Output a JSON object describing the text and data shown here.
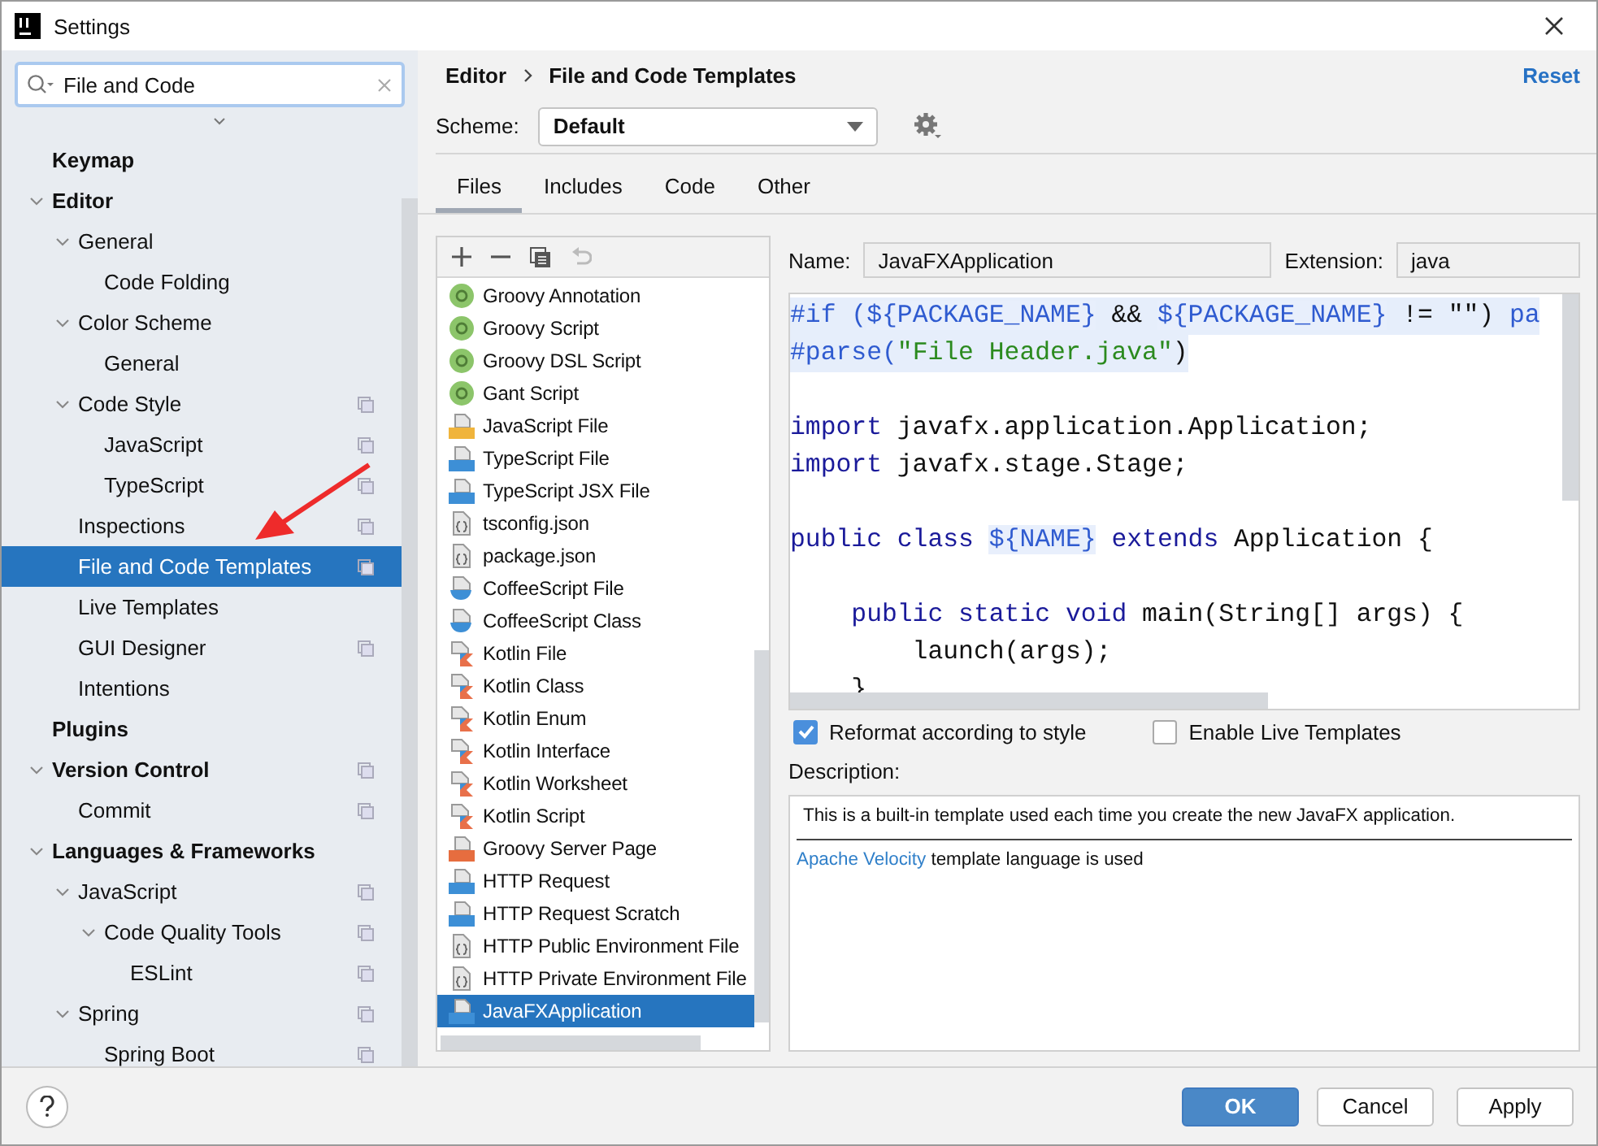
{
  "window": {
    "title": "Settings"
  },
  "search": {
    "value": "File and Code"
  },
  "tree": [
    {
      "label": "Keymap",
      "selected": false,
      "project_scoped": false
    },
    {
      "label": "Editor",
      "selected": false,
      "project_scoped": false,
      "expanded": true,
      "children": [
        {
          "label": "General",
          "selected": false,
          "project_scoped": false,
          "expanded": true,
          "children": [
            {
              "label": "Code Folding",
              "selected": false,
              "project_scoped": false
            }
          ]
        },
        {
          "label": "Color Scheme",
          "selected": false,
          "project_scoped": false,
          "expanded": true,
          "children": [
            {
              "label": "General",
              "selected": false,
              "project_scoped": false
            }
          ]
        },
        {
          "label": "Code Style",
          "selected": false,
          "project_scoped": true,
          "expanded": true,
          "children": [
            {
              "label": "JavaScript",
              "selected": false,
              "project_scoped": true
            },
            {
              "label": "TypeScript",
              "selected": false,
              "project_scoped": true
            }
          ]
        },
        {
          "label": "Inspections",
          "selected": false,
          "project_scoped": true
        },
        {
          "label": "File and Code Templates",
          "selected": true,
          "project_scoped": true
        },
        {
          "label": "Live Templates",
          "selected": false,
          "project_scoped": false
        },
        {
          "label": "GUI Designer",
          "selected": false,
          "project_scoped": true
        },
        {
          "label": "Intentions",
          "selected": false,
          "project_scoped": false
        }
      ]
    },
    {
      "label": "Plugins",
      "selected": false,
      "project_scoped": false
    },
    {
      "label": "Version Control",
      "selected": false,
      "project_scoped": true,
      "expanded": true,
      "children": [
        {
          "label": "Commit",
          "selected": false,
          "project_scoped": true
        }
      ]
    },
    {
      "label": "Languages & Frameworks",
      "selected": false,
      "project_scoped": false,
      "expanded": true,
      "children": [
        {
          "label": "JavaScript",
          "selected": false,
          "project_scoped": true,
          "expanded": true,
          "children": [
            {
              "label": "Code Quality Tools",
              "selected": false,
              "project_scoped": true,
              "expanded": true,
              "children": [
                {
                  "label": "ESLint",
                  "selected": false,
                  "project_scoped": true
                }
              ]
            }
          ]
        },
        {
          "label": "Spring",
          "selected": false,
          "project_scoped": true,
          "expanded": true,
          "children": [
            {
              "label": "Spring Boot",
              "selected": false,
              "project_scoped": true
            }
          ]
        }
      ]
    }
  ],
  "breadcrumb": [
    "Editor",
    "File and Code Templates"
  ],
  "reset": "Reset",
  "scheme": {
    "label": "Scheme:",
    "value": "Default"
  },
  "tabs": [
    {
      "label": "Files",
      "selected": true
    },
    {
      "label": "Includes",
      "selected": false
    },
    {
      "label": "Code",
      "selected": false
    },
    {
      "label": "Other",
      "selected": false
    }
  ],
  "templates": [
    {
      "label": "Groovy Annotation",
      "kind": "groovy",
      "selected": false
    },
    {
      "label": "Groovy Script",
      "kind": "groovy",
      "selected": false
    },
    {
      "label": "Groovy DSL Script",
      "kind": "groovy",
      "selected": false
    },
    {
      "label": "Gant Script",
      "kind": "groovy",
      "selected": false
    },
    {
      "label": "JavaScript File",
      "kind": "js",
      "selected": false
    },
    {
      "label": "TypeScript File",
      "kind": "ts",
      "selected": false
    },
    {
      "label": "TypeScript JSX File",
      "kind": "tsx",
      "selected": false
    },
    {
      "label": "tsconfig.json",
      "kind": "json",
      "selected": false
    },
    {
      "label": "package.json",
      "kind": "json",
      "selected": false
    },
    {
      "label": "CoffeeScript File",
      "kind": "coffee",
      "selected": false
    },
    {
      "label": "CoffeeScript Class",
      "kind": "coffee",
      "selected": false
    },
    {
      "label": "Kotlin File",
      "kind": "kotlin",
      "selected": false
    },
    {
      "label": "Kotlin Class",
      "kind": "kotlin",
      "selected": false
    },
    {
      "label": "Kotlin Enum",
      "kind": "kotlin",
      "selected": false
    },
    {
      "label": "Kotlin Interface",
      "kind": "kotlin",
      "selected": false
    },
    {
      "label": "Kotlin Worksheet",
      "kind": "kotlin",
      "selected": false
    },
    {
      "label": "Kotlin Script",
      "kind": "kotlin",
      "selected": false
    },
    {
      "label": "Groovy Server Page",
      "kind": "gsp",
      "selected": false
    },
    {
      "label": "HTTP Request",
      "kind": "api",
      "selected": false
    },
    {
      "label": "HTTP Request Scratch",
      "kind": "api",
      "selected": false
    },
    {
      "label": "HTTP Public Environment File",
      "kind": "json",
      "selected": false
    },
    {
      "label": "HTTP Private Environment File",
      "kind": "json",
      "selected": false
    },
    {
      "label": "JavaFXApplication",
      "kind": "java",
      "selected": true
    }
  ],
  "name": {
    "label": "Name:",
    "value": "JavaFXApplication"
  },
  "extension": {
    "label": "Extension:",
    "value": "java"
  },
  "code": [
    {
      "kind": "code",
      "velocity": true,
      "segments": [
        {
          "text": "#if (",
          "kind": "directive"
        },
        {
          "text": "${PACKAGE_NAME}",
          "kind": "variable"
        },
        {
          "text": " && ",
          "kind": "plain"
        },
        {
          "text": "${PACKAGE_NAME}",
          "kind": "variable"
        },
        {
          "text": " != \"\")",
          "kind": "plain"
        },
        {
          "text": " pa",
          "kind": "directive"
        }
      ]
    },
    {
      "kind": "code",
      "velocity": true,
      "segments": [
        {
          "text": "#parse(",
          "kind": "directive"
        },
        {
          "text": "\"File Header.java\"",
          "kind": "string"
        },
        {
          "text": ")",
          "kind": "plain"
        }
      ]
    },
    {
      "kind": "blank"
    },
    {
      "kind": "code",
      "velocity": false,
      "segments": [
        {
          "text": "import",
          "kind": "keyword"
        },
        {
          "text": " javafx.application.Application;",
          "kind": "plain"
        }
      ]
    },
    {
      "kind": "code",
      "velocity": false,
      "segments": [
        {
          "text": "import",
          "kind": "keyword"
        },
        {
          "text": " javafx.stage.Stage;",
          "kind": "plain"
        }
      ]
    },
    {
      "kind": "blank"
    },
    {
      "kind": "code",
      "velocity": false,
      "segments": [
        {
          "text": "public class ",
          "kind": "keyword"
        },
        {
          "text": "${NAME}",
          "kind": "variable"
        },
        {
          "text": " extends",
          "kind": "keyword"
        },
        {
          "text": " Application {",
          "kind": "plain"
        }
      ]
    },
    {
      "kind": "blank"
    },
    {
      "kind": "code",
      "velocity": false,
      "segments": [
        {
          "text": "    public static void",
          "kind": "keyword"
        },
        {
          "text": " main(String[] args) {",
          "kind": "plain"
        }
      ]
    },
    {
      "kind": "code",
      "velocity": false,
      "segments": [
        {
          "text": "        launch(args);",
          "kind": "plain"
        }
      ]
    },
    {
      "kind": "code",
      "velocity": false,
      "segments": [
        {
          "text": "    }",
          "kind": "plain"
        }
      ]
    }
  ],
  "options": [
    {
      "label": "Reformat according to style",
      "checked": true
    },
    {
      "label": "Enable Live Templates",
      "checked": false
    }
  ],
  "description": {
    "label": "Description:",
    "text": "This is a built-in template used each time you create the new JavaFX application.",
    "link": "Apache Velocity",
    "link_suffix": "template language is used"
  },
  "buttons": [
    {
      "label": "OK",
      "kind": "primary"
    },
    {
      "label": "Cancel",
      "kind": "normal"
    },
    {
      "label": "Apply",
      "kind": "normal"
    }
  ]
}
